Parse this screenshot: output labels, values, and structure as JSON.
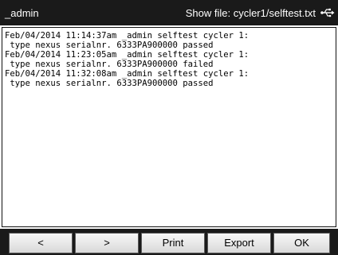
{
  "header": {
    "user": "_admin",
    "title": "Show file: cycler1/selftest.txt",
    "status_icon": "usb-icon"
  },
  "file_content": {
    "lines": [
      "Feb/04/2014 11:14:37am _admin selftest cycler 1:",
      " type nexus serialnr. 6333PA900000 passed",
      "Feb/04/2014 11:23:05am _admin selftest cycler 1:",
      " type nexus serialnr. 6333PA900000 failed",
      "Feb/04/2014 11:32:08am _admin selftest cycler 1:",
      " type nexus serialnr. 6333PA900000 passed"
    ]
  },
  "toolbar": {
    "prev_label": "<",
    "next_label": ">",
    "print_label": "Print",
    "export_label": "Export",
    "ok_label": "OK"
  }
}
